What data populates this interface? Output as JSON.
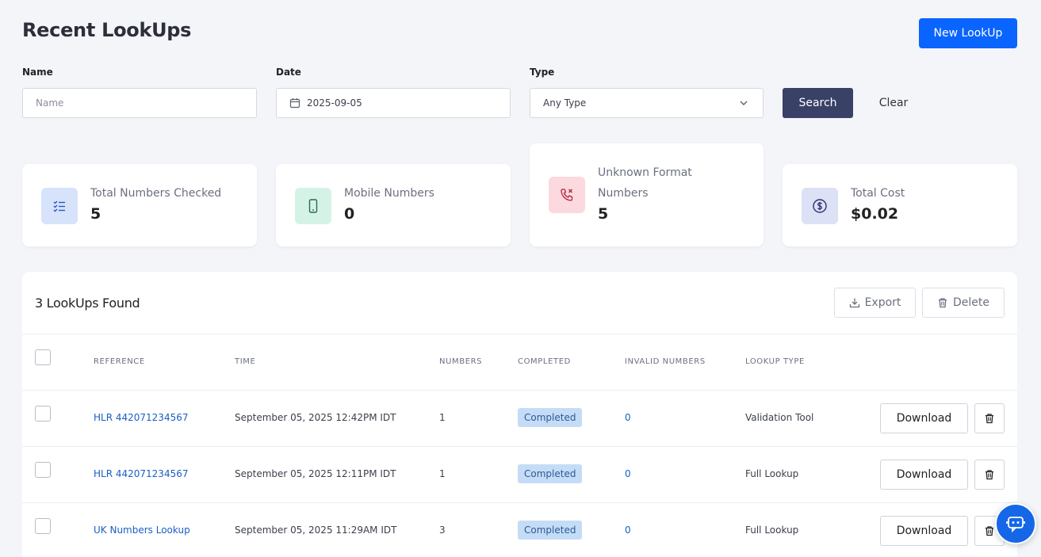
{
  "header": {
    "title": "Recent LookUps",
    "new_lookup_label": "New LookUp"
  },
  "filters": {
    "name_label": "Name",
    "name_placeholder": "Name",
    "date_label": "Date",
    "date_value": "2025-09-05",
    "type_label": "Type",
    "type_value": "Any Type",
    "search_label": "Search",
    "clear_label": "Clear"
  },
  "stats": [
    {
      "label": "Total Numbers Checked",
      "value": "5",
      "icon": "checklist-icon",
      "icon_bg": "#d6e3fb",
      "icon_color": "#2b57c4"
    },
    {
      "label": "Mobile Numbers",
      "value": "0",
      "icon": "mobile-phone-icon",
      "icon_bg": "#d4f3e6",
      "icon_color": "#2a6a4f"
    },
    {
      "label": "Unknown Format Numbers",
      "value": "5",
      "icon": "phone-missed-icon",
      "icon_bg": "#fbd9de",
      "icon_color": "#b3233b"
    },
    {
      "label": "Total Cost",
      "value": "$0.02",
      "icon": "dollar-circle-icon",
      "icon_bg": "#dde1f6",
      "icon_color": "#2d3270"
    }
  ],
  "results": {
    "title": "3 LookUps Found",
    "export_label": "Export",
    "delete_label": "Delete",
    "columns": [
      "REFERENCE",
      "TIME",
      "NUMBERS",
      "COMPLETED",
      "INVALID NUMBERS",
      "LOOKUP TYPE"
    ],
    "rows": [
      {
        "reference": "HLR 442071234567",
        "time": "September 05, 2025 12:42PM IDT",
        "numbers": "1",
        "completed": "Completed",
        "invalid": "0",
        "type": "Validation Tool",
        "download": "Download"
      },
      {
        "reference": "HLR 442071234567",
        "time": "September 05, 2025 12:11PM IDT",
        "numbers": "1",
        "completed": "Completed",
        "invalid": "0",
        "type": "Full Lookup",
        "download": "Download"
      },
      {
        "reference": "UK Numbers Lookup",
        "time": "September 05, 2025 11:29AM IDT",
        "numbers": "3",
        "completed": "Completed",
        "invalid": "0",
        "type": "Full Lookup",
        "download": "Download"
      }
    ]
  },
  "colors": {
    "primary": "#0a64ff",
    "search_button": "#3a4166",
    "link": "#1a5fc4",
    "badge_bg": "#c5dcf7",
    "chat_fab": "#1667e8"
  }
}
